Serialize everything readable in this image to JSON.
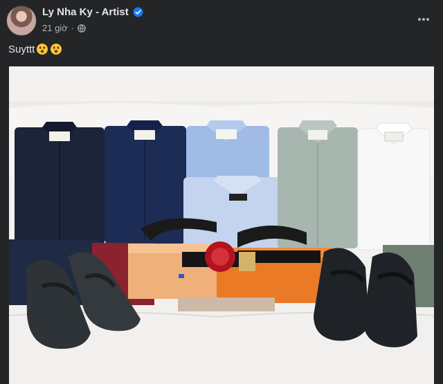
{
  "post": {
    "author": "Ly Nha Ky - Artist",
    "time": "21 giờ",
    "caption_text": "Suyttt",
    "caption_emojis": [
      "hushed-face-emoji",
      "hushed-face-emoji"
    ],
    "more_icon": "more-horizontal-icon",
    "privacy_icon": "globe-icon",
    "verified_icon": "verified-badge-icon",
    "colors": {
      "background": "#242526",
      "text_primary": "#e4e6eb",
      "text_secondary": "#b0b3b8",
      "verified_blue": "#1877f2"
    }
  }
}
